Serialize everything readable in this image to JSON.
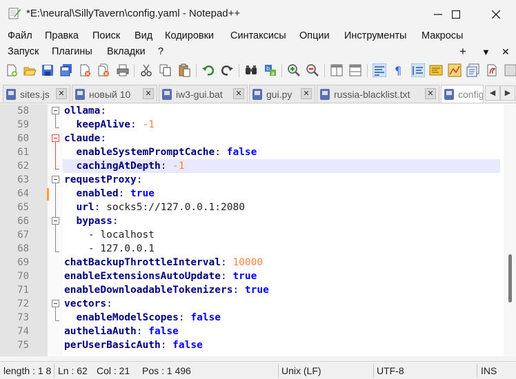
{
  "window": {
    "title": "*E:\\neural\\SillyTavern\\config.yaml - Notepad++"
  },
  "menu": {
    "row1": [
      "Файл",
      "Правка",
      "Поиск",
      "Вид",
      "Кодировки",
      "Синтаксисы",
      "Опции",
      "Инструменты",
      "Макросы"
    ],
    "row2": [
      "Запуск",
      "Плагины",
      "Вкладки",
      "?"
    ],
    "right": {
      "plus": "+",
      "down": "▼",
      "close": "✕"
    }
  },
  "toolbar": {
    "icons": [
      "new-file",
      "open-file",
      "save",
      "save-all",
      "close",
      "close-all",
      "print",
      "cut",
      "copy",
      "paste",
      "undo",
      "redo",
      "find",
      "replace",
      "zoom-in",
      "zoom-out",
      "sync-vertical",
      "sync-horizontal",
      "word-wrap",
      "show-all-chars",
      "indent-guide",
      "user-defined-language",
      "document-map",
      "function-list",
      "folder-as-workspace",
      "macro-record"
    ]
  },
  "tabs": [
    {
      "label": "sites.js"
    },
    {
      "label": "новый 10"
    },
    {
      "label": "iw3-gui.bat"
    },
    {
      "label": "gui.py"
    },
    {
      "label": "russia-blacklist.txt"
    },
    {
      "label": "config"
    }
  ],
  "tab_nav": {
    "left": "◀",
    "right": "▶"
  },
  "editor": {
    "lines": [
      {
        "n": "58",
        "indent": "",
        "key": "ollama",
        "colon": ":",
        "value": "",
        "vtype": ""
      },
      {
        "n": "59",
        "indent": "  ",
        "key": "keepAlive",
        "colon": ": ",
        "value": "-1",
        "vtype": "num"
      },
      {
        "n": "60",
        "indent": "",
        "key": "claude",
        "colon": ":",
        "value": "",
        "vtype": ""
      },
      {
        "n": "61",
        "indent": "  ",
        "key": "enableSystemPromptCache",
        "colon": ": ",
        "value": "false",
        "vtype": "bool"
      },
      {
        "n": "62",
        "indent": "  ",
        "key": "cachingAtDepth",
        "colon": ": ",
        "value": "-1",
        "vtype": "num"
      },
      {
        "n": "63",
        "indent": "",
        "key": "requestProxy",
        "colon": ":",
        "value": "",
        "vtype": ""
      },
      {
        "n": "64",
        "indent": "  ",
        "key": "enabled",
        "colon": ": ",
        "value": "true",
        "vtype": "bool"
      },
      {
        "n": "65",
        "indent": "  ",
        "key": "url",
        "colon": ": ",
        "value": "socks5://127.0.0.1:2080",
        "vtype": "str"
      },
      {
        "n": "66",
        "indent": "  ",
        "key": "bypass",
        "colon": ":",
        "value": "",
        "vtype": ""
      },
      {
        "n": "67",
        "indent": "    ",
        "key": "",
        "colon": "",
        "value": "- localhost",
        "vtype": "str"
      },
      {
        "n": "68",
        "indent": "    ",
        "key": "",
        "colon": "",
        "value": "- 127.0.0.1",
        "vtype": "str"
      },
      {
        "n": "69",
        "indent": "",
        "key": "chatBackupThrottleInterval",
        "colon": ": ",
        "value": "10000",
        "vtype": "num"
      },
      {
        "n": "70",
        "indent": "",
        "key": "enableExtensionsAutoUpdate",
        "colon": ": ",
        "value": "true",
        "vtype": "bool"
      },
      {
        "n": "71",
        "indent": "",
        "key": "enableDownloadableTokenizers",
        "colon": ": ",
        "value": "true",
        "vtype": "bool"
      },
      {
        "n": "72",
        "indent": "",
        "key": "vectors",
        "colon": ":",
        "value": "",
        "vtype": ""
      },
      {
        "n": "73",
        "indent": "  ",
        "key": "enableModelScopes",
        "colon": ": ",
        "value": "false",
        "vtype": "bool"
      },
      {
        "n": "74",
        "indent": "",
        "key": "autheliaAuth",
        "colon": ": ",
        "value": "false",
        "vtype": "bool"
      },
      {
        "n": "75",
        "indent": "",
        "key": "perUserBasicAuth",
        "colon": ": ",
        "value": "false",
        "vtype": "bool"
      }
    ],
    "current_line": "62"
  },
  "status": {
    "length": "length : 1 8",
    "ln": "Ln : 62",
    "col": "Col : 21",
    "pos": "Pos : 1 496",
    "eol": "Unix (LF)",
    "encoding": "UTF-8",
    "mode": "INS"
  },
  "colors": {
    "keyword": "#000080",
    "number": "#ff8040",
    "boolean": "#0000ff",
    "current_line_bg": "#e8e8ff",
    "change_marker": "#ff9a36",
    "fold_active": "#e05050"
  }
}
